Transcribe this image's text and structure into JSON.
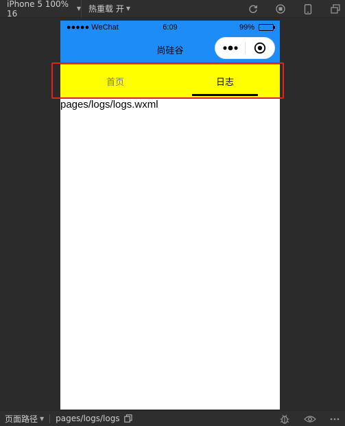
{
  "toolbar": {
    "device_label": "iPhone 5 100% 16",
    "hotreload_label": "热重载 开",
    "icons": [
      "refresh-icon",
      "stop-icon",
      "phone-icon",
      "window-icon"
    ]
  },
  "phone": {
    "status": {
      "carrier": "●●●●● WeChat",
      "time": "6:09",
      "battery": "99%"
    },
    "nav": {
      "title": "尚硅谷"
    },
    "tabs": [
      {
        "label": "首页",
        "active": false
      },
      {
        "label": "日志",
        "active": true
      }
    ],
    "content": {
      "text": "pages/logs/logs.wxml"
    }
  },
  "bottombar": {
    "path_label": "页面路径",
    "path_value": "pages/logs/logs"
  },
  "colors": {
    "navbar": "#1e8cf6",
    "tabbar": "#ffff00",
    "highlight": "#e0241b"
  }
}
